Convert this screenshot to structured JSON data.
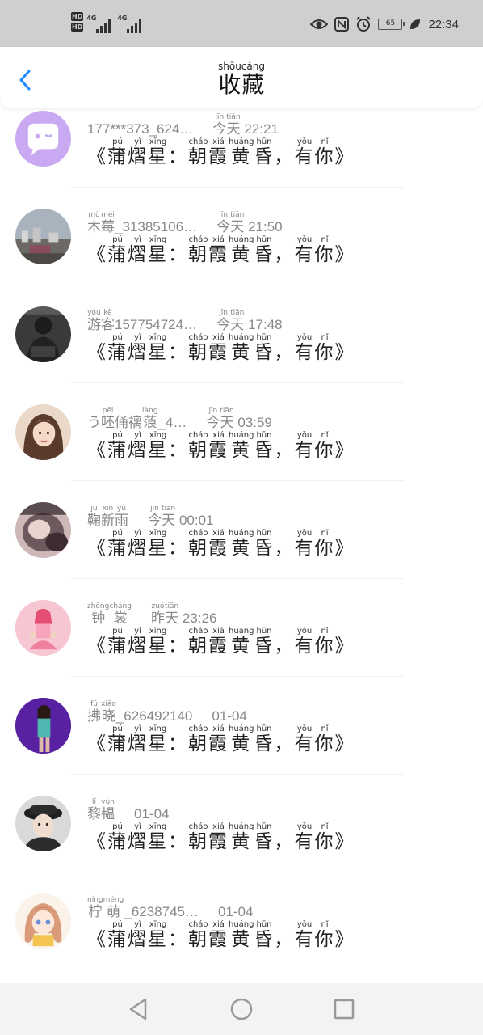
{
  "status_bar": {
    "hd1": "HD",
    "hd2": "HD",
    "net1": "4G",
    "net2": "4G",
    "battery": "65",
    "time": "22:34",
    "icons": [
      "eye-icon",
      "nfc-icon",
      "alarm-icon",
      "battery-icon",
      "leaf-icon"
    ]
  },
  "header": {
    "title": [
      {
        "c": "收",
        "p": "shōu"
      },
      {
        "c": "藏",
        "p": "cáng"
      }
    ]
  },
  "song_title": [
    {
      "c": "《",
      "p": ""
    },
    {
      "c": "蒲",
      "p": "pú"
    },
    {
      "c": "熠",
      "p": "yì"
    },
    {
      "c": "星",
      "p": "xīng"
    },
    {
      "c": "：",
      "p": ""
    },
    {
      "c": "朝",
      "p": "cháo"
    },
    {
      "c": "霞",
      "p": "xiá"
    },
    {
      "c": "黄",
      "p": "huáng"
    },
    {
      "c": "昏",
      "p": "hūn"
    },
    {
      "c": "，",
      "p": ""
    },
    {
      "c": "有",
      "p": "yǒu"
    },
    {
      "c": "你",
      "p": "nǐ"
    },
    {
      "c": "》",
      "p": ""
    }
  ],
  "items": [
    {
      "avatar": "chat-bubble",
      "user": [
        {
          "c": "177***373_624…",
          "p": ""
        }
      ],
      "when": [
        {
          "c": "今",
          "p": "jīn"
        },
        {
          "c": "天",
          "p": "tiān"
        },
        {
          "c": " 22:21",
          "p": ""
        }
      ]
    },
    {
      "avatar": "city-photo",
      "user": [
        {
          "c": "木",
          "p": "mù"
        },
        {
          "c": "莓",
          "p": "méi"
        },
        {
          "c": "_31385106…",
          "p": ""
        }
      ],
      "when": [
        {
          "c": "今",
          "p": "jīn"
        },
        {
          "c": "天",
          "p": "tiān"
        },
        {
          "c": " 21:50",
          "p": ""
        }
      ]
    },
    {
      "avatar": "dark-person",
      "user": [
        {
          "c": "游",
          "p": "yóu"
        },
        {
          "c": "客",
          "p": "kè"
        },
        {
          "c": "157754724…",
          "p": ""
        }
      ],
      "when": [
        {
          "c": "今",
          "p": "jīn"
        },
        {
          "c": "天",
          "p": "tiān"
        },
        {
          "c": " 17:48",
          "p": ""
        }
      ]
    },
    {
      "avatar": "girl-portrait",
      "user": [
        {
          "c": "う",
          "p": ""
        },
        {
          "c": "呸",
          "p": "pēi"
        },
        {
          "c": "俑",
          "p": ""
        },
        {
          "c": "䄜",
          "p": ""
        },
        {
          "c": "蒗",
          "p": "làng"
        },
        {
          "c": "_4…",
          "p": ""
        }
      ],
      "when": [
        {
          "c": "今",
          "p": "jīn"
        },
        {
          "c": "天",
          "p": "tiān"
        },
        {
          "c": " 03:59",
          "p": ""
        }
      ]
    },
    {
      "avatar": "blurred-portrait",
      "user": [
        {
          "c": "鞠",
          "p": "jū"
        },
        {
          "c": "新",
          "p": "xīn"
        },
        {
          "c": "雨",
          "p": "yǔ"
        }
      ],
      "when": [
        {
          "c": "今",
          "p": "jīn"
        },
        {
          "c": "天",
          "p": "tiān"
        },
        {
          "c": " 00:01",
          "p": ""
        }
      ]
    },
    {
      "avatar": "pink-cartoon",
      "user": [
        {
          "c": "钟裳",
          "p": "zhōngcháng"
        }
      ],
      "when": [
        {
          "c": "昨",
          "p": "zuó"
        },
        {
          "c": "天",
          "p": "tiān"
        },
        {
          "c": " 23:26",
          "p": ""
        }
      ]
    },
    {
      "avatar": "purple-stage",
      "user": [
        {
          "c": "拂",
          "p": "fú"
        },
        {
          "c": "晓",
          "p": "xiǎo"
        },
        {
          "c": "_626492140",
          "p": ""
        }
      ],
      "when": [
        {
          "c": "01-04",
          "p": ""
        }
      ]
    },
    {
      "avatar": "hat-portrait",
      "user": [
        {
          "c": "黎",
          "p": "lí"
        },
        {
          "c": "韫",
          "p": "yùn"
        }
      ],
      "when": [
        {
          "c": "01-04",
          "p": ""
        }
      ]
    },
    {
      "avatar": "anime-girl",
      "user": [
        {
          "c": "柠",
          "p": "níng"
        },
        {
          "c": "萌",
          "p": "méng"
        },
        {
          "c": "_6238745…",
          "p": ""
        }
      ],
      "when": [
        {
          "c": "01-04",
          "p": ""
        }
      ]
    }
  ],
  "nav": {
    "icons": [
      "back-triangle-icon",
      "home-circle-icon",
      "recents-square-icon"
    ]
  },
  "colors": {
    "accent": "#1a8cff",
    "status_bar": "#cfcfcf",
    "meta_text": "#888888"
  }
}
